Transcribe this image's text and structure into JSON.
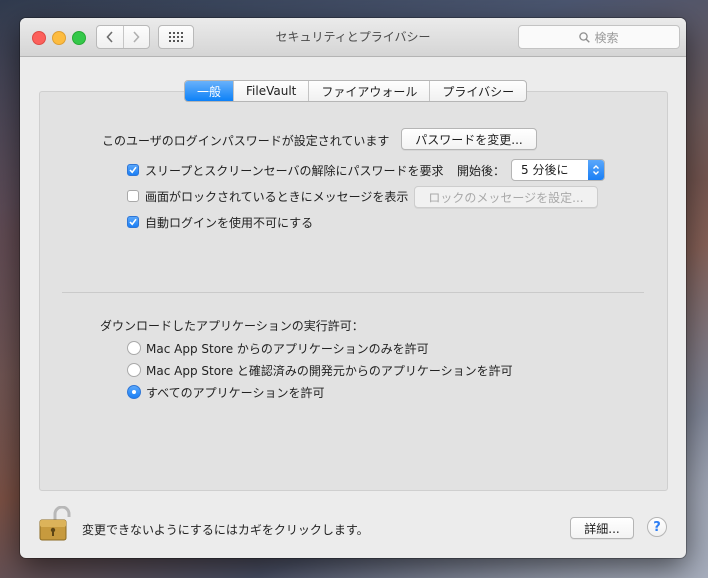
{
  "window": {
    "title": "セキュリティとプライバシー",
    "search_placeholder": "検索"
  },
  "tabs": [
    {
      "label": "一般",
      "active": true
    },
    {
      "label": "FileVault",
      "active": false
    },
    {
      "label": "ファイアウォール",
      "active": false
    },
    {
      "label": "プライバシー",
      "active": false
    }
  ],
  "general": {
    "password_label": "このユーザのログインパスワードが設定されています",
    "change_password_button": "パスワードを変更...",
    "require_password": {
      "label": "スリープとスクリーンセーバの解除にパスワードを要求",
      "checked": true
    },
    "after_label": "開始後：",
    "after_value": "5 分後に",
    "show_message": {
      "label": "画面がロックされているときにメッセージを表示",
      "checked": false
    },
    "set_lock_message_button": "ロックのメッセージを設定...",
    "disable_auto_login": {
      "label": "自動ログインを使用不可にする",
      "checked": true
    }
  },
  "downloads": {
    "heading": "ダウンロードしたアプリケーションの実行許可：",
    "options": [
      {
        "label": "Mac App Store からのアプリケーションのみを許可",
        "selected": false
      },
      {
        "label": "Mac App Store と確認済みの開発元からのアプリケーションを許可",
        "selected": false
      },
      {
        "label": "すべてのアプリケーションを許可",
        "selected": true
      }
    ]
  },
  "footer": {
    "lock_text": "変更できないようにするにはカギをクリックします。",
    "advanced_button": "詳細...",
    "help_label": "?"
  },
  "colors": {
    "accent": "#1a7ff5",
    "close": "#fc605c",
    "minimize": "#fdbc40",
    "maximize": "#34c84a"
  }
}
